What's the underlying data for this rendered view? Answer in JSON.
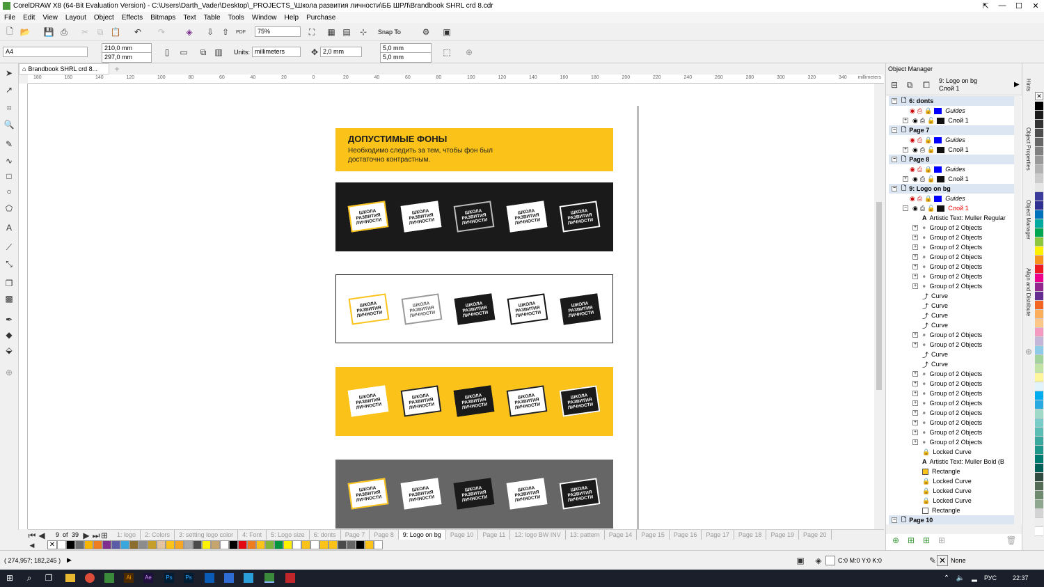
{
  "window": {
    "title": "CorelDRAW X8 (64-Bit Evaluation Version) - C:\\Users\\Darth_Vader\\Desktop\\_PROJECTS_\\Школа развития личности\\ББ ШРЛ\\Brandbook SHRL crd 8.cdr"
  },
  "menu": [
    "File",
    "Edit",
    "View",
    "Layout",
    "Object",
    "Effects",
    "Bitmaps",
    "Text",
    "Table",
    "Tools",
    "Window",
    "Help",
    "Purchase"
  ],
  "toolbar": {
    "zoom": "75%",
    "snap": "Snap To",
    "page_size": "A4",
    "width": "210,0 mm",
    "height": "297,0 mm",
    "units_label": "Units:",
    "units": "millimeters",
    "nudge": "2,0 mm",
    "dup_x": "5,0 mm",
    "dup_y": "5,0 mm"
  },
  "doc_tab": "Brandbook SHRL crd 8...",
  "ruler": {
    "unit": "millimeters",
    "ticks": [
      "180",
      "160",
      "140",
      "120",
      "100",
      "80",
      "60",
      "40",
      "20",
      "0",
      "20",
      "40",
      "60",
      "80",
      "100",
      "120",
      "140",
      "160",
      "180",
      "200",
      "220",
      "240",
      "260",
      "280",
      "300",
      "320",
      "340"
    ]
  },
  "page": {
    "title": "ДОПУСТИМЫЕ ФОНЫ",
    "subtitle": "Необходимо следить за тем, чтобы фон был достаточно контрастным.",
    "logo_text": "ШКОЛА РАЗВИТИЯ ЛИЧНОСТИ",
    "panels": [
      {
        "bg": "#1a1a1a",
        "logos": [
          {
            "bg": "#fff",
            "fg": "#111",
            "border": "#fbc31a"
          },
          {
            "bg": "#fff",
            "fg": "#111",
            "border": "#fff"
          },
          {
            "bg": "#1a1a1a",
            "fg": "#fff",
            "border": "#bbb"
          },
          {
            "bg": "#fff",
            "fg": "#111",
            "border": "#fff"
          },
          {
            "bg": "#1a1a1a",
            "fg": "#fff",
            "border": "#fff"
          }
        ]
      },
      {
        "bg": "#ffffff",
        "logos": [
          {
            "bg": "#fff",
            "fg": "#111",
            "border": "#fbc31a"
          },
          {
            "bg": "#fff",
            "fg": "#555",
            "border": "#999"
          },
          {
            "bg": "#1a1a1a",
            "fg": "#fff",
            "border": "#1a1a1a"
          },
          {
            "bg": "#fff",
            "fg": "#111",
            "border": "#111"
          },
          {
            "bg": "#1a1a1a",
            "fg": "#fff",
            "border": "#1a1a1a"
          }
        ]
      },
      {
        "bg": "#fbc31a",
        "logos": [
          {
            "bg": "#fff",
            "fg": "#111",
            "border": "#fff"
          },
          {
            "bg": "#fff",
            "fg": "#111",
            "border": "#222"
          },
          {
            "bg": "#1a1a1a",
            "fg": "#fff",
            "border": "#1a1a1a"
          },
          {
            "bg": "#fff",
            "fg": "#111",
            "border": "#222"
          },
          {
            "bg": "#1a1a1a",
            "fg": "#fff",
            "border": "#fff"
          }
        ]
      },
      {
        "bg": "#666666",
        "logos": [
          {
            "bg": "#fff",
            "fg": "#111",
            "border": "#fbc31a"
          },
          {
            "bg": "#fff",
            "fg": "#111",
            "border": "#fff"
          },
          {
            "bg": "#1a1a1a",
            "fg": "#fff",
            "border": "#1a1a1a"
          },
          {
            "bg": "#fff",
            "fg": "#111",
            "border": "#fff"
          },
          {
            "bg": "#1a1a1a",
            "fg": "#fff",
            "border": "#fff"
          }
        ]
      }
    ]
  },
  "pager": {
    "current": "9",
    "of": "of",
    "total": "39"
  },
  "page_tabs": [
    "1: logo",
    "2: Colors",
    "3: setting logo color",
    "4: Font",
    "5: Logo size",
    "6: donts",
    "Page 7",
    "Page 8",
    "9: Logo on bg",
    "Page 10",
    "Page 11",
    "12: logo BW INV",
    "13: pattern",
    "Page 14",
    "Page 15",
    "Page 16",
    "Page 17",
    "Page 18",
    "Page 19",
    "Page 20"
  ],
  "active_tab": "9: Logo on bg",
  "palette": [
    "#ffffff",
    "#000000",
    "#6d6e70",
    "#f7b500",
    "#ee7d22",
    "#7f2f8e",
    "#5b5ea6",
    "#3aa7dc",
    "#8a6d2f",
    "#8c8c8c",
    "#c59f2a",
    "#e3c3a0",
    "#fbc31a",
    "#f5a623",
    "#a8a8a8",
    "#4a4a4a",
    "#fff200",
    "#c5a46d",
    "#ffffff",
    "#000000",
    "#e30613",
    "#ee7d22",
    "#fbc31a",
    "#7fb539",
    "#009640",
    "#fff200",
    "#ffffff",
    "#fbc31a",
    "#ffffff",
    "#fbc31a",
    "#fbc31a",
    "#4a4a4a",
    "#666666",
    "#000000",
    "#fbc31a",
    "#ffffff"
  ],
  "status": {
    "coords": "( 274,957; 182,245 )",
    "fill": "C:0 M:0 Y:0 K:0",
    "outline": "None"
  },
  "taskbar": {
    "lang": "РУС",
    "time": "22:37"
  },
  "object_manager": {
    "title": "Object Manager",
    "current": "9: Logo on bg",
    "current_layer": "Слой 1",
    "rows": [
      {
        "t": "6: donts",
        "k": "page"
      },
      {
        "t": "Guides",
        "k": "guides"
      },
      {
        "t": "Слой 1",
        "k": "layer"
      },
      {
        "t": "Page 7",
        "k": "page"
      },
      {
        "t": "Guides",
        "k": "guides"
      },
      {
        "t": "Слой 1",
        "k": "layer"
      },
      {
        "t": "Page 8",
        "k": "page"
      },
      {
        "t": "Guides",
        "k": "guides"
      },
      {
        "t": "Слой 1",
        "k": "layer"
      },
      {
        "t": "9: Logo on bg",
        "k": "page"
      },
      {
        "t": "Guides",
        "k": "guides"
      },
      {
        "t": "Слой 1",
        "k": "activelayer"
      },
      {
        "t": "Artistic Text: Muller Regular",
        "k": "text"
      },
      {
        "t": "Group of 2 Objects",
        "k": "group"
      },
      {
        "t": "Group of 2 Objects",
        "k": "group"
      },
      {
        "t": "Group of 2 Objects",
        "k": "group"
      },
      {
        "t": "Group of 2 Objects",
        "k": "group"
      },
      {
        "t": "Group of 2 Objects",
        "k": "group"
      },
      {
        "t": "Group of 2 Objects",
        "k": "group"
      },
      {
        "t": "Group of 2 Objects",
        "k": "group"
      },
      {
        "t": "Curve",
        "k": "curve"
      },
      {
        "t": "Curve",
        "k": "curve"
      },
      {
        "t": "Curve",
        "k": "curve"
      },
      {
        "t": "Curve",
        "k": "curve"
      },
      {
        "t": "Group of 2 Objects",
        "k": "group"
      },
      {
        "t": "Group of 2 Objects",
        "k": "group"
      },
      {
        "t": "Curve",
        "k": "curve"
      },
      {
        "t": "Curve",
        "k": "curve"
      },
      {
        "t": "Group of 2 Objects",
        "k": "group"
      },
      {
        "t": "Group of 2 Objects",
        "k": "group"
      },
      {
        "t": "Group of 2 Objects",
        "k": "group"
      },
      {
        "t": "Group of 2 Objects",
        "k": "group"
      },
      {
        "t": "Group of 2 Objects",
        "k": "group"
      },
      {
        "t": "Group of 2 Objects",
        "k": "group"
      },
      {
        "t": "Group of 2 Objects",
        "k": "group"
      },
      {
        "t": "Group of 2 Objects",
        "k": "group"
      },
      {
        "t": "Locked Curve",
        "k": "locked"
      },
      {
        "t": "Artistic Text: Muller Bold (B",
        "k": "text"
      },
      {
        "t": "Rectangle",
        "k": "rectfill"
      },
      {
        "t": "Locked Curve",
        "k": "locked"
      },
      {
        "t": "Locked Curve",
        "k": "locked"
      },
      {
        "t": "Locked Curve",
        "k": "locked"
      },
      {
        "t": "Rectangle",
        "k": "rect"
      },
      {
        "t": "Page 10",
        "k": "page"
      }
    ]
  },
  "dock_tabs": [
    "Hints",
    "Object Properties",
    "Object Manager",
    "Align and Distribute"
  ],
  "vertical_palette": [
    "#000000",
    "#1a1a1a",
    "#333333",
    "#4d4d4d",
    "#666666",
    "#808080",
    "#999999",
    "#b3b3b3",
    "#cccccc",
    "#e6e6e6",
    "#3c3c9c",
    "#2e3192",
    "#0072bc",
    "#00a99d",
    "#00a651",
    "#8dc63f",
    "#fff200",
    "#f7941d",
    "#ed1c24",
    "#ec008c",
    "#92278f",
    "#662d91",
    "#f26522",
    "#fbaf5d",
    "#fdc689",
    "#f49ac1",
    "#c4b6d9",
    "#8fcbe9",
    "#a3d39c",
    "#c2e3a6",
    "#fef69b",
    "#e1f4fb",
    "#00aeef",
    "#29abe2",
    "#a0d9c8",
    "#7accc8",
    "#5bbdb3",
    "#3aa89c",
    "#1e968a",
    "#007b70",
    "#005f56",
    "#324b41",
    "#556b55",
    "#6f8a6f",
    "#8fa68f",
    "#d4d4d4",
    "#eeeeee",
    "#ffffff"
  ]
}
